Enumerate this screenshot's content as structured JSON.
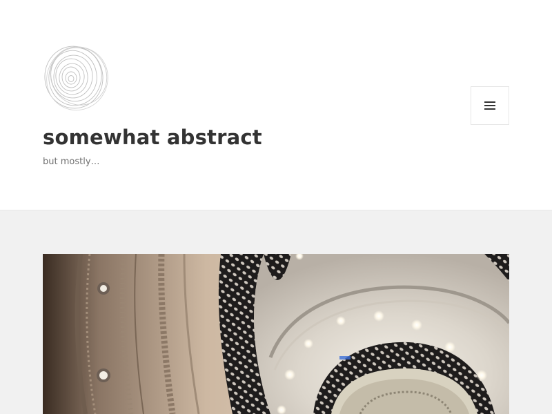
{
  "site": {
    "title": "somewhat abstract",
    "description": "but mostly…",
    "logo_icon": "spiral-logo-icon"
  },
  "header": {
    "menu_toggle_icon": "hamburger-menu-icon"
  },
  "post": {
    "featured_image_subject": "spiral staircase viewed from below"
  },
  "colors": {
    "header_bg": "#ffffff",
    "page_bg": "#f1f1f1",
    "title_color": "#333333",
    "description_color": "#707070"
  }
}
